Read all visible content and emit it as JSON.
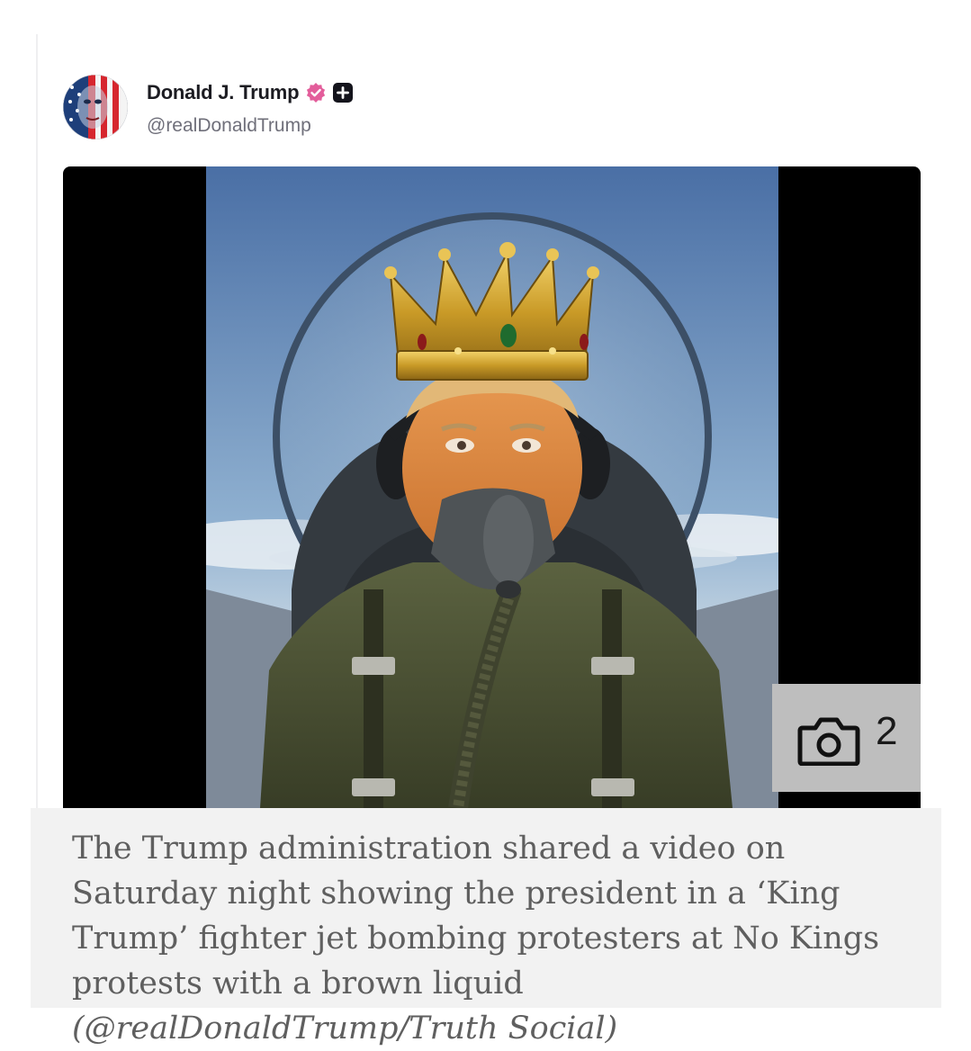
{
  "post": {
    "author_name": "Donald J. Trump",
    "author_handle": "@realDonaldTrump",
    "avatar_icon": "flag-portrait-avatar",
    "verified_icon": "verified-badge-icon",
    "verified_color": "#e35d9b",
    "extra_icon": "plus-square-icon"
  },
  "media": {
    "image_alt": "AI-generated image of Trump wearing a gold crown in a fighter jet cockpit with oxygen mask",
    "gallery_icon": "camera-icon",
    "gallery_count": "2"
  },
  "caption": {
    "text": "The Trump administration shared a video on Saturday night showing the president in a ‘King Trump’ fighter jet bombing protesters at No Kings protests with a brown liquid",
    "credit": "(@realDonaldTrump/Truth Social)"
  }
}
